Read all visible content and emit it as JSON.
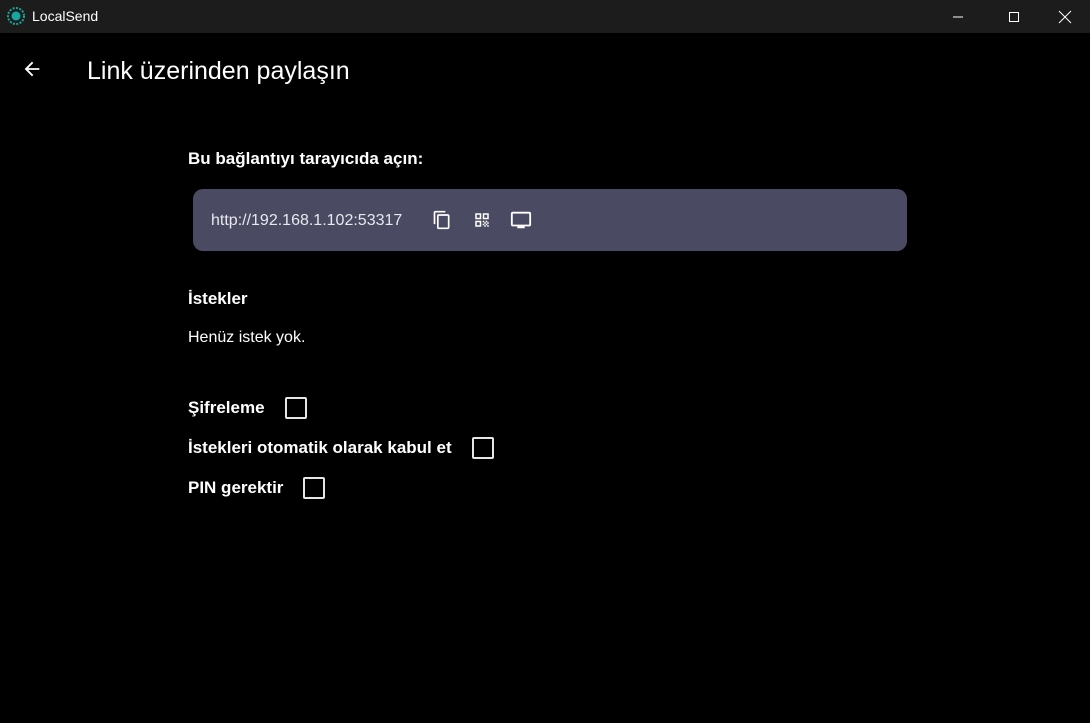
{
  "window": {
    "title": "LocalSend",
    "accent_color": "#1aa6a0"
  },
  "header": {
    "back_icon": "arrow-left-icon",
    "title": "Link üzerinden paylaşın"
  },
  "link_section": {
    "heading": "Bu bağlantıyı tarayıcıda açın:",
    "url": "http://192.168.1.102:53317",
    "card_color": "#4a4a63",
    "actions": [
      {
        "icon": "copy-icon"
      },
      {
        "icon": "qr-code-icon"
      },
      {
        "icon": "monitor-icon"
      }
    ]
  },
  "requests": {
    "heading": "İstekler",
    "empty_text": "Henüz istek yok."
  },
  "options": [
    {
      "label": "Şifreleme",
      "checked": false
    },
    {
      "label": "İstekleri otomatik olarak kabul et",
      "checked": false
    },
    {
      "label": "PIN gerektir",
      "checked": false
    }
  ]
}
